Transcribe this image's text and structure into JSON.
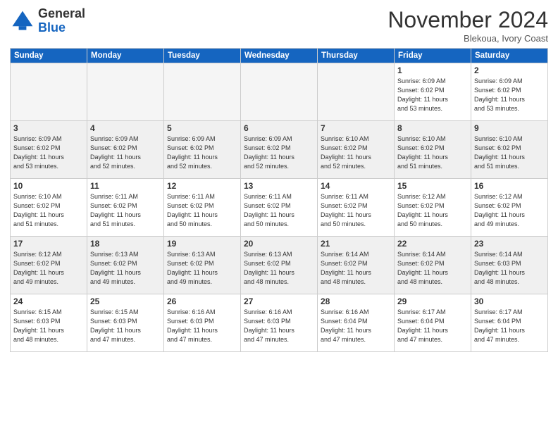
{
  "logo": {
    "general": "General",
    "blue": "Blue"
  },
  "header": {
    "month": "November 2024",
    "location": "Blekoua, Ivory Coast"
  },
  "weekdays": [
    "Sunday",
    "Monday",
    "Tuesday",
    "Wednesday",
    "Thursday",
    "Friday",
    "Saturday"
  ],
  "weeks": [
    [
      {
        "day": "",
        "info": ""
      },
      {
        "day": "",
        "info": ""
      },
      {
        "day": "",
        "info": ""
      },
      {
        "day": "",
        "info": ""
      },
      {
        "day": "",
        "info": ""
      },
      {
        "day": "1",
        "info": "Sunrise: 6:09 AM\nSunset: 6:02 PM\nDaylight: 11 hours\nand 53 minutes."
      },
      {
        "day": "2",
        "info": "Sunrise: 6:09 AM\nSunset: 6:02 PM\nDaylight: 11 hours\nand 53 minutes."
      }
    ],
    [
      {
        "day": "3",
        "info": "Sunrise: 6:09 AM\nSunset: 6:02 PM\nDaylight: 11 hours\nand 53 minutes."
      },
      {
        "day": "4",
        "info": "Sunrise: 6:09 AM\nSunset: 6:02 PM\nDaylight: 11 hours\nand 52 minutes."
      },
      {
        "day": "5",
        "info": "Sunrise: 6:09 AM\nSunset: 6:02 PM\nDaylight: 11 hours\nand 52 minutes."
      },
      {
        "day": "6",
        "info": "Sunrise: 6:09 AM\nSunset: 6:02 PM\nDaylight: 11 hours\nand 52 minutes."
      },
      {
        "day": "7",
        "info": "Sunrise: 6:10 AM\nSunset: 6:02 PM\nDaylight: 11 hours\nand 52 minutes."
      },
      {
        "day": "8",
        "info": "Sunrise: 6:10 AM\nSunset: 6:02 PM\nDaylight: 11 hours\nand 51 minutes."
      },
      {
        "day": "9",
        "info": "Sunrise: 6:10 AM\nSunset: 6:02 PM\nDaylight: 11 hours\nand 51 minutes."
      }
    ],
    [
      {
        "day": "10",
        "info": "Sunrise: 6:10 AM\nSunset: 6:02 PM\nDaylight: 11 hours\nand 51 minutes."
      },
      {
        "day": "11",
        "info": "Sunrise: 6:11 AM\nSunset: 6:02 PM\nDaylight: 11 hours\nand 51 minutes."
      },
      {
        "day": "12",
        "info": "Sunrise: 6:11 AM\nSunset: 6:02 PM\nDaylight: 11 hours\nand 50 minutes."
      },
      {
        "day": "13",
        "info": "Sunrise: 6:11 AM\nSunset: 6:02 PM\nDaylight: 11 hours\nand 50 minutes."
      },
      {
        "day": "14",
        "info": "Sunrise: 6:11 AM\nSunset: 6:02 PM\nDaylight: 11 hours\nand 50 minutes."
      },
      {
        "day": "15",
        "info": "Sunrise: 6:12 AM\nSunset: 6:02 PM\nDaylight: 11 hours\nand 50 minutes."
      },
      {
        "day": "16",
        "info": "Sunrise: 6:12 AM\nSunset: 6:02 PM\nDaylight: 11 hours\nand 49 minutes."
      }
    ],
    [
      {
        "day": "17",
        "info": "Sunrise: 6:12 AM\nSunset: 6:02 PM\nDaylight: 11 hours\nand 49 minutes."
      },
      {
        "day": "18",
        "info": "Sunrise: 6:13 AM\nSunset: 6:02 PM\nDaylight: 11 hours\nand 49 minutes."
      },
      {
        "day": "19",
        "info": "Sunrise: 6:13 AM\nSunset: 6:02 PM\nDaylight: 11 hours\nand 49 minutes."
      },
      {
        "day": "20",
        "info": "Sunrise: 6:13 AM\nSunset: 6:02 PM\nDaylight: 11 hours\nand 48 minutes."
      },
      {
        "day": "21",
        "info": "Sunrise: 6:14 AM\nSunset: 6:02 PM\nDaylight: 11 hours\nand 48 minutes."
      },
      {
        "day": "22",
        "info": "Sunrise: 6:14 AM\nSunset: 6:02 PM\nDaylight: 11 hours\nand 48 minutes."
      },
      {
        "day": "23",
        "info": "Sunrise: 6:14 AM\nSunset: 6:03 PM\nDaylight: 11 hours\nand 48 minutes."
      }
    ],
    [
      {
        "day": "24",
        "info": "Sunrise: 6:15 AM\nSunset: 6:03 PM\nDaylight: 11 hours\nand 48 minutes."
      },
      {
        "day": "25",
        "info": "Sunrise: 6:15 AM\nSunset: 6:03 PM\nDaylight: 11 hours\nand 47 minutes."
      },
      {
        "day": "26",
        "info": "Sunrise: 6:16 AM\nSunset: 6:03 PM\nDaylight: 11 hours\nand 47 minutes."
      },
      {
        "day": "27",
        "info": "Sunrise: 6:16 AM\nSunset: 6:03 PM\nDaylight: 11 hours\nand 47 minutes."
      },
      {
        "day": "28",
        "info": "Sunrise: 6:16 AM\nSunset: 6:04 PM\nDaylight: 11 hours\nand 47 minutes."
      },
      {
        "day": "29",
        "info": "Sunrise: 6:17 AM\nSunset: 6:04 PM\nDaylight: 11 hours\nand 47 minutes."
      },
      {
        "day": "30",
        "info": "Sunrise: 6:17 AM\nSunset: 6:04 PM\nDaylight: 11 hours\nand 47 minutes."
      }
    ]
  ]
}
